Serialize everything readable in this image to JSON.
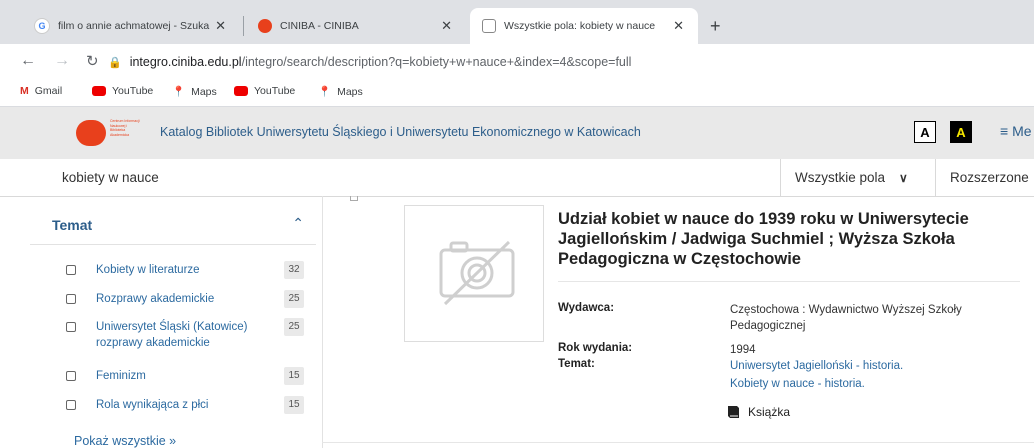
{
  "browser": {
    "tabs": [
      {
        "title": "film o annie achmatowej - Szuka",
        "icon": "google-icon",
        "active": false
      },
      {
        "title": "CINIBA - CINIBA",
        "icon": "ciniba-icon",
        "active": false
      },
      {
        "title": "Wszystkie pola: kobiety w nauce",
        "icon": "library-icon",
        "active": true
      }
    ],
    "new_tab_label": "+",
    "url_host": "integro.ciniba.edu.pl",
    "url_path": "/integro/search/description?q=kobiety+w+nauce+&index=4&scope=full",
    "bookmarks": [
      {
        "label": "Gmail",
        "icon": "gmail-icon"
      },
      {
        "label": "YouTube",
        "icon": "youtube-icon"
      },
      {
        "label": "Maps",
        "icon": "maps-icon"
      },
      {
        "label": "YouTube",
        "icon": "youtube-icon"
      },
      {
        "label": "Maps",
        "icon": "maps-icon"
      }
    ]
  },
  "header": {
    "catalog_title": "Katalog Bibliotek Uniwersytetu Śląskiego i Uniwersytetu Ekonomicznego w Katowicach",
    "logo_text": "Centrum Informacji Naukowej i Biblioteka Akademicka",
    "contrast_normal": "A",
    "contrast_high": "A",
    "menu_label": "Me"
  },
  "search": {
    "query": "kobiety w nauce",
    "scope": "Wszystkie pola",
    "advanced": "Rozszerzone"
  },
  "facet": {
    "title": "Temat",
    "items": [
      {
        "label": "Kobiety w literaturze",
        "count": "32"
      },
      {
        "label": "Rozprawy akademickie",
        "count": "25"
      },
      {
        "label": "Uniwersytet Śląski (Katowice) rozprawy akademickie",
        "label_line1": "Uniwersytet Śląski (Katowice)",
        "label_line2": "rozprawy akademickie",
        "count": "25"
      },
      {
        "label": "Feminizm",
        "count": "15"
      },
      {
        "label": "Rola wynikająca z płci",
        "count": "15"
      }
    ],
    "show_all": "Pokaż wszystkie »"
  },
  "record": {
    "title": "Udział kobiet w nauce do 1939 roku w Uniwersytecie Jagiellońskim / Jadwiga Suchmiel ; Wyższa Szkoła Pedagogiczna w Częstochowie",
    "title_line1": "Udział kobiet w nauce do 1939 roku w Uniwersytecie",
    "title_line2": "Jagiellońskim / Jadwiga Suchmiel ; Wyższa Szkoła",
    "title_line3": "Pedagogiczna w Częstochowie",
    "publisher_label": "Wydawca:",
    "publisher_line1": "Częstochowa : Wydawnictwo Wyższej Szkoły",
    "publisher_line2": "Pedagogicznej",
    "year_label": "Rok wydania:",
    "year": "1994",
    "subject_label": "Temat:",
    "subjects": [
      "Uniwersytet Jagielloński - historia.",
      "Kobiety w nauce - historia."
    ],
    "type": "Książka"
  },
  "colors": {
    "accent_link": "#2c6aa0",
    "brand_red": "#e8401c",
    "contrast_yellow": "#f5e600"
  }
}
